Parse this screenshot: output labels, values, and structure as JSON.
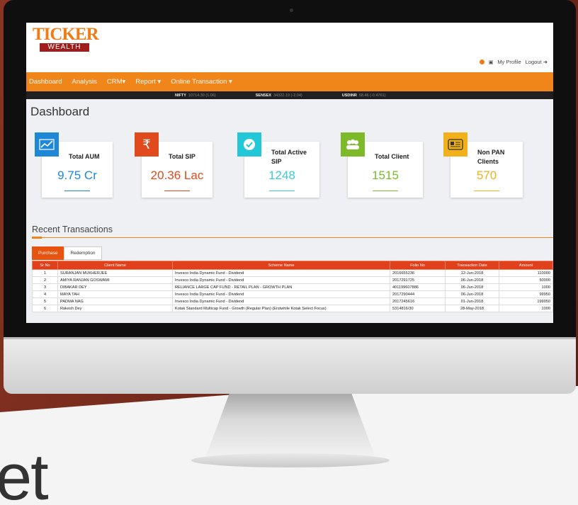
{
  "brand": {
    "logo_top": "TICKER",
    "logo_bottom": "WEALTH"
  },
  "user_menu": {
    "profile": "My Profile",
    "logout": "Logout"
  },
  "nav": [
    "Dashboard",
    "Analysis",
    "CRM▾",
    "Report ▾",
    "Online Transaction ▾"
  ],
  "ticker": [
    {
      "name": "NIFTY",
      "value": "10714.30 (1.06)"
    },
    {
      "name": "SENSEX",
      "value": "34322.19 (-2.04)"
    },
    {
      "name": "USDINR",
      "value": "68.46 (-0.4761)"
    }
  ],
  "page_title": "Dashboard",
  "cards": [
    {
      "title": "Total AUM",
      "value": "9.75 Cr",
      "icon": "chart-trend-icon",
      "color": "#1e88d6"
    },
    {
      "title": "Total SIP",
      "value": "20.36 Lac",
      "icon": "rupee-icon",
      "color": "#e04a1c"
    },
    {
      "title": "Total Active SIP",
      "value": "1248",
      "icon": "check-circle-icon",
      "color": "#22c8d8"
    },
    {
      "title": "Total Client",
      "value": "1515",
      "icon": "users-icon",
      "color": "#7cba2a"
    },
    {
      "title": "Non PAN Clients",
      "value": "570",
      "icon": "id-card-icon",
      "color": "#f2b01b"
    }
  ],
  "recent": {
    "title": "Recent Transactions",
    "tabs": [
      "Purchase",
      "Redemption"
    ],
    "columns": [
      "Sr No",
      "Client Name",
      "Scheme Name",
      "Folio No",
      "Transaction Date",
      "Amount"
    ],
    "rows": [
      [
        "1",
        "SURANJAN MUKHERJEE",
        "Invesco India Dynamic Fund - Dividend",
        "2016655236",
        "12-Jun-2018",
        "110000"
      ],
      [
        "2",
        "AMIYA RANJAN GOSWAMI",
        "Invesco India Dynamic Fund - Dividend",
        "2017291725",
        "06-Jun-2018",
        "50000"
      ],
      [
        "3",
        "DIBAKAR DEY",
        "RELIANCE LARGE CAP FUND - RETAIL PLAN - GROWTH PLAN",
        "401199607886",
        "06-Jun-2018",
        "1000"
      ],
      [
        "4",
        "MAYA TAH",
        "Invesco India Dynamic Fund - Dividend",
        "2017290444",
        "06-Jun-2018",
        "99950"
      ],
      [
        "5",
        "PADMA NAG",
        "Invesco India Dynamic Fund - Dividend",
        "2017245616",
        "01-Jun-2018",
        "199950"
      ],
      [
        "6",
        "Rakesh Dey",
        "Kotak Standard Multicap Fund - Growth (Regular Plan) (Erstwhile Kotak Select Focus)",
        "5314816/30",
        "28-May-2018",
        "1000"
      ]
    ]
  },
  "background_text": "et"
}
